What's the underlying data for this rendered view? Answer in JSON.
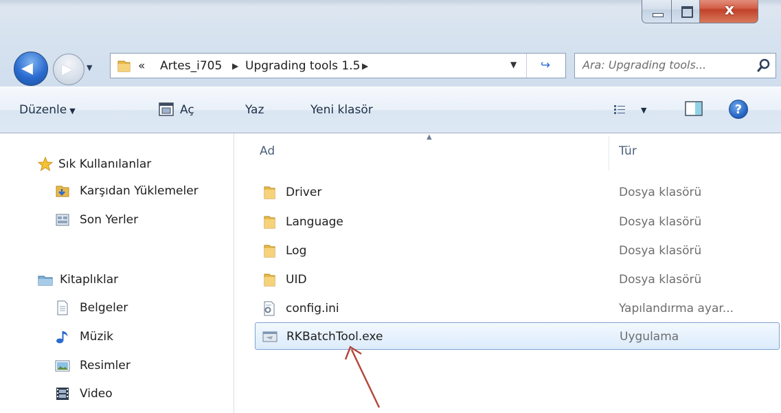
{
  "window": {
    "close_glyph": "x"
  },
  "address_bar": {
    "overflow": "«",
    "crumbs": [
      "Artes_i705",
      "Upgrading tools 1.5"
    ],
    "chevron": "▶"
  },
  "search": {
    "placeholder": "Ara: Upgrading tools..."
  },
  "command_bar": {
    "organize": "Düzenle",
    "open": "Aç",
    "print": "Yaz",
    "new_folder": "Yeni klasör",
    "help": "?"
  },
  "nav_pane": {
    "favorites": "Sık Kullanılanlar",
    "downloads": "Karşıdan Yüklemeler",
    "recent": "Son Yerler",
    "libraries": "Kitaplıklar",
    "documents": "Belgeler",
    "music": "Müzik",
    "pictures": "Resimler",
    "video": "Video"
  },
  "file_list": {
    "columns": {
      "name": "Ad",
      "type": "Tür"
    },
    "rows": [
      {
        "name": "Driver",
        "type": "Dosya klasörü",
        "icon": "folder-icon"
      },
      {
        "name": "Language",
        "type": "Dosya klasörü",
        "icon": "folder-icon"
      },
      {
        "name": "Log",
        "type": "Dosya klasörü",
        "icon": "folder-icon"
      },
      {
        "name": "UID",
        "type": "Dosya klasörü",
        "icon": "folder-icon"
      },
      {
        "name": "config.ini",
        "type": "Yapılandırma ayar...",
        "icon": "settings-file-icon"
      },
      {
        "name": "RKBatchTool.exe",
        "type": "Uygulama",
        "icon": "application-icon",
        "selected": true
      }
    ]
  },
  "colors": {
    "annotation_arrow": "#b5473a",
    "selection_border": "#7da2ce",
    "folder": "#e8b94a"
  }
}
